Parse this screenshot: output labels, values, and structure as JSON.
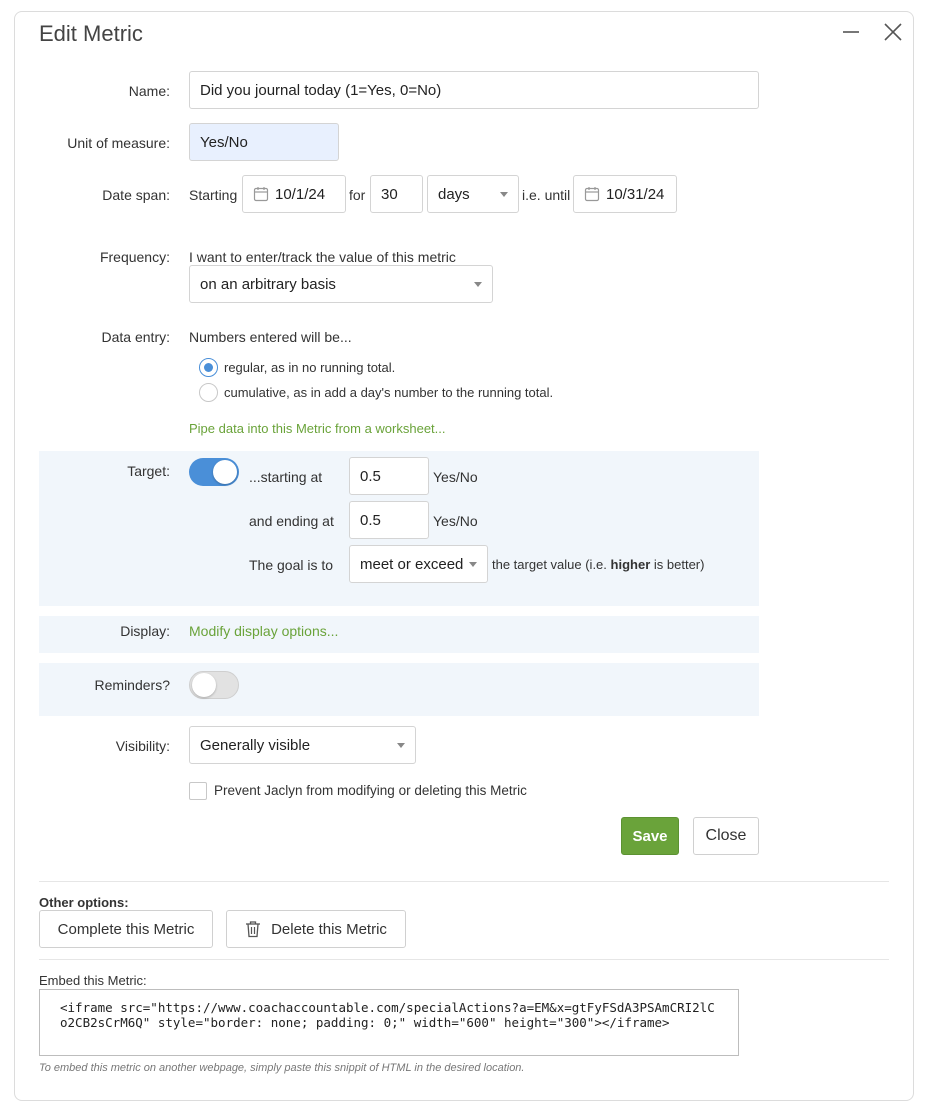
{
  "dialog": {
    "title": "Edit Metric",
    "minimize_icon": "minimize-icon",
    "close_icon": "close-icon"
  },
  "name": {
    "label": "Name:",
    "value": "Did you journal today (1=Yes, 0=No)"
  },
  "unit": {
    "label": "Unit of measure:",
    "value": "Yes/No"
  },
  "date_span": {
    "label": "Date span:",
    "starting_text": "Starting",
    "start_date": "10/1/24",
    "for_text": "for",
    "count": "30",
    "period": "days",
    "until_text": "i.e. until",
    "end_date": "10/31/24"
  },
  "frequency": {
    "label": "Frequency:",
    "description": "I want to enter/track the value of this metric",
    "selected": "on an arbitrary basis"
  },
  "data_entry": {
    "label": "Data entry:",
    "description": "Numbers entered will be...",
    "options": [
      {
        "label": "regular, as in no running total.",
        "selected": true
      },
      {
        "label": "cumulative, as in add a day's number to the running total.",
        "selected": false
      }
    ],
    "pipe_link": "Pipe data into this Metric from a worksheet..."
  },
  "target": {
    "label": "Target:",
    "enabled": true,
    "starting_label": "...starting at",
    "starting_value": "0.5",
    "starting_unit": "Yes/No",
    "ending_label": "and ending at",
    "ending_value": "0.5",
    "ending_unit": "Yes/No",
    "goal_label": "The goal is to",
    "goal_selected": "meet or exceed",
    "goal_suffix_pre": "the target value (i.e.",
    "goal_suffix_bold": "higher",
    "goal_suffix_post": "is better)"
  },
  "display": {
    "label": "Display:",
    "link": "Modify display options..."
  },
  "reminders": {
    "label": "Reminders?",
    "enabled": false
  },
  "visibility": {
    "label": "Visibility:",
    "selected": "Generally visible"
  },
  "prevent": {
    "label": "Prevent Jaclyn from modifying or deleting this Metric",
    "checked": false
  },
  "actions": {
    "save": "Save",
    "close": "Close"
  },
  "other_options": {
    "heading": "Other options:",
    "complete": "Complete this Metric",
    "delete": "Delete this Metric"
  },
  "embed": {
    "heading": "Embed this Metric:",
    "code": "<iframe src=\"https://www.coachaccountable.com/specialActions?a=EM&x=gtFyFSdA3PSAmCRI2lCo2CB2sCrM6Q\" style=\"border: none; padding: 0;\" width=\"600\" height=\"300\"></iframe>",
    "note": "To embed this metric on another webpage, simply paste this snippit of HTML in the desired location."
  },
  "colors": {
    "accent_green": "#6aa33a",
    "toggle_blue": "#4a8fd8",
    "band_bg": "#f1f6fb",
    "unit_bg": "#e8f0fe"
  }
}
